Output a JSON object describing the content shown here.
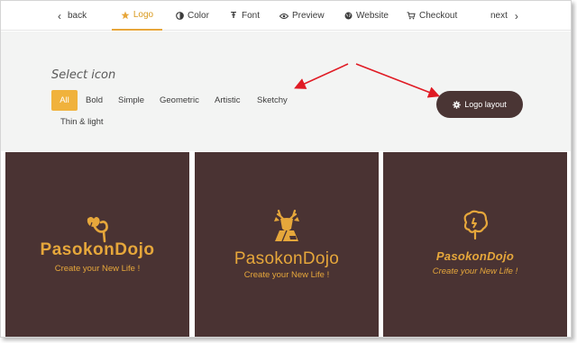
{
  "nav": {
    "back": "back",
    "items": [
      {
        "label": "Logo",
        "icon": "star-icon",
        "active": true
      },
      {
        "label": "Color",
        "icon": "half-circle-icon"
      },
      {
        "label": "Font",
        "icon": "font-icon"
      },
      {
        "label": "Preview",
        "icon": "eye-icon"
      },
      {
        "label": "Website",
        "icon": "globe-icon"
      },
      {
        "label": "Checkout",
        "icon": "cart-icon"
      }
    ],
    "next": "next"
  },
  "select_icon": {
    "title": "Select icon",
    "filters": [
      "All",
      "Bold",
      "Simple",
      "Geometric",
      "Artistic",
      "Sketchy",
      "Thin & light"
    ],
    "active_filter": "All"
  },
  "logo_layout_button": "Logo layout",
  "cards": [
    {
      "brand": "PasokonDojo",
      "tagline": "Create your New Life !",
      "icon": "flower-icon"
    },
    {
      "brand": "PasokonDojo",
      "tagline": "Create your New Life !",
      "icon": "deer-icon"
    },
    {
      "brand": "PasokonDojo",
      "tagline": "Create your New Life !",
      "icon": "brain-icon"
    }
  ],
  "colors": {
    "accent": "#f0b23c",
    "card_bg": "#4a3333",
    "logo_text": "#e6a73b",
    "arrow": "#e01b24"
  }
}
